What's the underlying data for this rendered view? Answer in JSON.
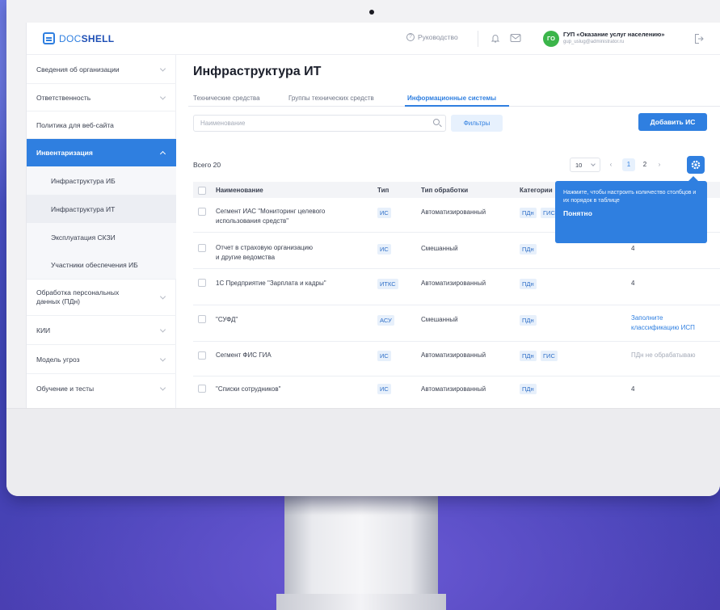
{
  "header": {
    "logo_prefix": "DOC",
    "logo_suffix": "SHELL",
    "help_label": "Руководство",
    "avatar_initials": "ГО",
    "org_name": "ГУП «Оказание услуг населению»",
    "user_email": "gup_uslug@administrator.ru"
  },
  "sidebar": {
    "items": [
      {
        "label": "Сведения об организации"
      },
      {
        "label": "Ответственность"
      },
      {
        "label": "Политика для веб-сайта"
      },
      {
        "label": "Инвентаризация"
      },
      {
        "label": "Инфраструктура ИБ"
      },
      {
        "label": "Инфраструктура ИТ"
      },
      {
        "label": "Эксплуатация СКЗИ"
      },
      {
        "label": "Участники обеспечения ИБ"
      },
      {
        "label": "Обработка персональных данных (ПДн)"
      },
      {
        "label": "КИИ"
      },
      {
        "label": "Модель угроз"
      },
      {
        "label": "Обучение и тесты"
      }
    ]
  },
  "main": {
    "title": "Инфраструктура ИТ",
    "tabs": [
      "Технические средства",
      "Группы технических средств",
      "Информационные системы"
    ],
    "search_placeholder": "Наименование",
    "filters_label": "Фильтры",
    "add_label": "Добавить ИС",
    "total_label": "Всего 20",
    "page_size": "10",
    "pages": [
      "1",
      "2"
    ]
  },
  "table": {
    "headers": [
      "Наименование",
      "Тип",
      "Тип обработки",
      "Категории"
    ],
    "rows": [
      {
        "name1": "Сегмент ИАС \"Мониторинг целевого",
        "name2": "использования средств\"",
        "type": "ИС",
        "processing": "Автоматизированный",
        "cat1": "ПДн",
        "cat2": "ГИС",
        "extra": ""
      },
      {
        "name1": "Отчет в страховую организацию",
        "name2": "и другие ведомства",
        "type": "ИС",
        "processing": "Смешанный",
        "cat1": "ПДн",
        "cat2": "",
        "extra": "4"
      },
      {
        "name1": "1С Предприятие \"Зарплата и кадры\"",
        "name2": "",
        "type": "ИТКС",
        "processing": "Автоматизированный",
        "cat1": "ПДн",
        "cat2": "",
        "extra": "4"
      },
      {
        "name1": "\"СУФД\"",
        "name2": "",
        "type": "АСУ",
        "processing": "Смешанный",
        "cat1": "ПДн",
        "cat2": "",
        "extra": "Заполните классификацию ИСП"
      },
      {
        "name1": "Сегмент ФИС ГИА",
        "name2": "",
        "type": "ИС",
        "processing": "Автоматизированный",
        "cat1": "ПДн",
        "cat2": "ГИС",
        "extra": "ПДн не обрабатываю"
      },
      {
        "name1": "\"Списки сотрудников\"",
        "name2": "",
        "type": "ИС",
        "processing": "Автоматизированный",
        "cat1": "ПДн",
        "cat2": "",
        "extra": "4"
      }
    ]
  },
  "tooltip": {
    "text": "Нажмите, чтобы настроить количество столбцов и их порядок в таблице",
    "button": "Понятно"
  },
  "colors": {
    "accent": "#2f7fe0",
    "success": "#3bb54a"
  }
}
